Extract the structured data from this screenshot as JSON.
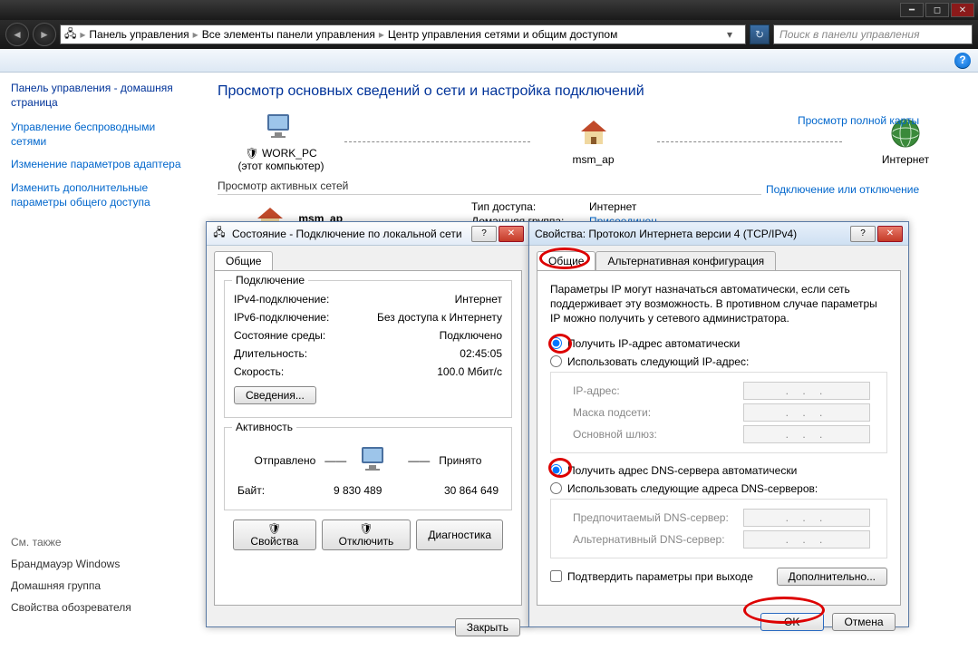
{
  "titlebar": {},
  "breadcrumb": {
    "root": "Панель управления",
    "mid": "Все элементы панели управления",
    "leaf": "Центр управления сетями и общим доступом"
  },
  "search": {
    "placeholder": "Поиск в панели управления"
  },
  "sidebar": {
    "home": "Панель управления - домашняя страница",
    "links": [
      "Управление беспроводными сетями",
      "Изменение параметров адаптера",
      "Изменить дополнительные параметры общего доступа"
    ],
    "seealso_title": "См. также",
    "seealso": [
      "Брандмауэр Windows",
      "Домашняя группа",
      "Свойства обозревателя"
    ]
  },
  "content": {
    "heading": "Просмотр основных сведений о сети и настройка подключений",
    "node_pc": "WORK_PC",
    "node_pc_sub": "(этот компьютер)",
    "node_ap": "msm_ap",
    "node_net": "Интернет",
    "fullmap": "Просмотр полной карты",
    "active_title": "Просмотр активных сетей",
    "connect_link": "Подключение или отключение",
    "msm_label": "msm_ap",
    "access_type_lbl": "Тип доступа:",
    "access_type_val": "Интернет",
    "homegroup_lbl": "Домашняя группа:",
    "homegroup_val": "Присоединен"
  },
  "status_dialog": {
    "title": "Состояние - Подключение по локальной сети",
    "tab": "Общие",
    "group_conn": "Подключение",
    "ipv4_lbl": "IPv4-подключение:",
    "ipv4_val": "Интернет",
    "ipv6_lbl": "IPv6-подключение:",
    "ipv6_val": "Без доступа к Интернету",
    "media_lbl": "Состояние среды:",
    "media_val": "Подключено",
    "duration_lbl": "Длительность:",
    "duration_val": "02:45:05",
    "speed_lbl": "Скорость:",
    "speed_val": "100.0 Мбит/с",
    "details_btn": "Сведения...",
    "group_act": "Активность",
    "sent_lbl": "Отправлено",
    "recv_lbl": "Принято",
    "bytes_lbl": "Байт:",
    "bytes_sent": "9 830 489",
    "bytes_recv": "30 864 649",
    "props_btn": "Свойства",
    "disable_btn": "Отключить",
    "diag_btn": "Диагностика",
    "close_btn": "Закрыть"
  },
  "ipv4_dialog": {
    "title": "Свойства: Протокол Интернета версии 4 (TCP/IPv4)",
    "tab1": "Общие",
    "tab2": "Альтернативная конфигурация",
    "helptext": "Параметры IP могут назначаться автоматически, если сеть поддерживает эту возможность. В противном случае параметры IP можно получить у сетевого администратора.",
    "radio_ip_auto": "Получить IP-адрес автоматически",
    "radio_ip_manual": "Использовать следующий IP-адрес:",
    "ip_lbl": "IP-адрес:",
    "mask_lbl": "Маска подсети:",
    "gw_lbl": "Основной шлюз:",
    "radio_dns_auto": "Получить адрес DNS-сервера автоматически",
    "radio_dns_manual": "Использовать следующие адреса DNS-серверов:",
    "dns1_lbl": "Предпочитаемый DNS-сервер:",
    "dns2_lbl": "Альтернативный DNS-сервер:",
    "validate_lbl": "Подтвердить параметры при выходе",
    "advanced_btn": "Дополнительно...",
    "ok_btn": "OK",
    "cancel_btn": "Отмена"
  }
}
